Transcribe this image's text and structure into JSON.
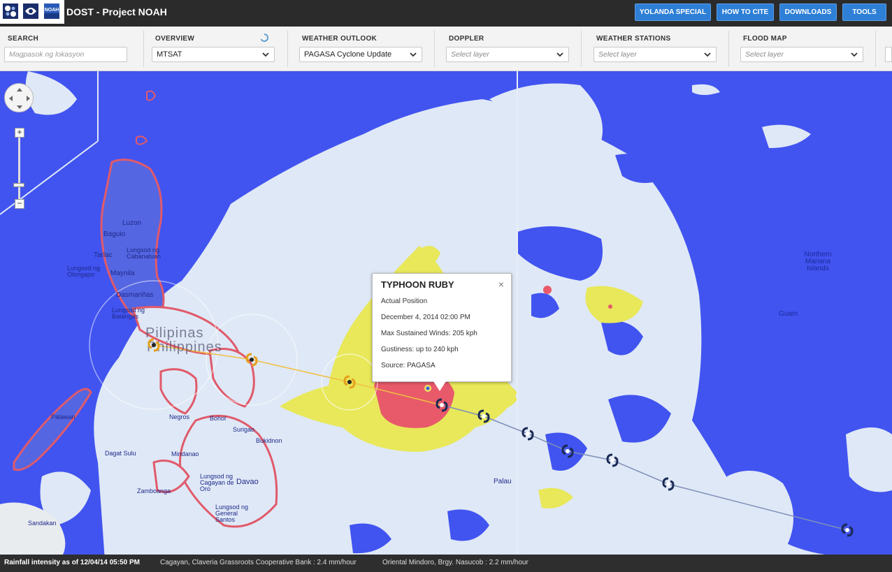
{
  "header": {
    "title": "DOST - Project NOAH",
    "buttons": [
      {
        "label": "YOLANDA SPECIAL"
      },
      {
        "label": "HOW TO CITE"
      },
      {
        "label": "DOWNLOADS"
      },
      {
        "label": "TOOLS"
      }
    ],
    "logos": [
      {
        "icon": "dost-logo-icon"
      },
      {
        "icon": "dost-logo-2-icon"
      },
      {
        "icon": "noah-logo-icon",
        "text": "NOAH"
      }
    ]
  },
  "filters": {
    "search": {
      "label": "SEARCH",
      "placeholder": "Magpasok ng lokasyon",
      "value": ""
    },
    "overview": {
      "label": "OVERVIEW",
      "value": "MTSAT",
      "icon": "loading-icon"
    },
    "weather_outlook": {
      "label": "WEATHER OUTLOOK",
      "value": "PAGASA Cyclone Update"
    },
    "doppler": {
      "label": "DOPPLER",
      "value": "Select layer"
    },
    "weather_stations": {
      "label": "WEATHER STATIONS",
      "value": "Select layer"
    },
    "flood_map": {
      "label": "FLOOD MAP",
      "value": "Select layer"
    }
  },
  "map": {
    "places": [
      {
        "name": "Luzon"
      },
      {
        "name": "Baguio"
      },
      {
        "name": "Lungsod ng Cabanatuan"
      },
      {
        "name": "Tarlac"
      },
      {
        "name": "Lungsod ng Olongapo"
      },
      {
        "name": "Maynila"
      },
      {
        "name": "Dasmariñas"
      },
      {
        "name": "Lungsod ng Batangas"
      },
      {
        "name": "Pilipinas"
      },
      {
        "name": "Philippines"
      },
      {
        "name": "Palawan"
      },
      {
        "name": "Negros"
      },
      {
        "name": "Bohol"
      },
      {
        "name": "Surigao"
      },
      {
        "name": "Bukidnon"
      },
      {
        "name": "Mindanao"
      },
      {
        "name": "Dagat Sulu"
      },
      {
        "name": "Lungsod ng Cagayan de Oro"
      },
      {
        "name": "Davao"
      },
      {
        "name": "Zamboanga"
      },
      {
        "name": "Lungsod ng General Santos"
      },
      {
        "name": "Sandakan"
      },
      {
        "name": "Palau"
      },
      {
        "name": "Northern Mariana Islands"
      },
      {
        "name": "Guam"
      }
    ],
    "zoom_in": "+",
    "zoom_out": "−"
  },
  "popup": {
    "title": "TYPHOON RUBY",
    "close": "×",
    "lines": [
      "Actual Position",
      "December 4, 2014 02:00 PM",
      "Max Sustained Winds: 205 kph",
      "Gustiness: up to 240 kph",
      "Source: PAGASA"
    ]
  },
  "storm_track": {
    "forecast_icon_color": "#e5a01b",
    "past_icon_color": "#1b2a55"
  },
  "ticker": {
    "items": [
      "Rainfall intensity as of 12/04/14 05:50 PM",
      "Cagayan, Claveria Grassroots Cooperative Bank : 2.4 mm/hour",
      "Oriental Mindoro, Brgy. Nasucob : 2.2 mm/hour"
    ]
  },
  "colors": {
    "ocean": "#4154f0",
    "cloud": "#dfe8f6",
    "light_rain": "#e8e85a",
    "heavy_rain": "#e85a6a",
    "accent_button": "#2e7fd6",
    "topbar": "#2b2b2b"
  }
}
